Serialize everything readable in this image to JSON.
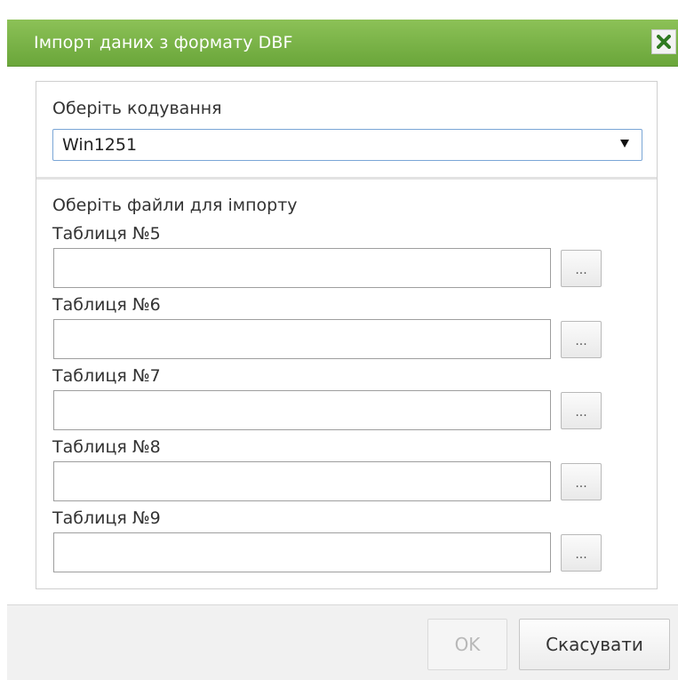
{
  "dialog": {
    "title": "Імпорт даних з формату DBF",
    "close_icon": "close-x-icon",
    "accent_color": "#7ab648"
  },
  "encoding": {
    "label": "Оберіть кодування",
    "selected": "Win1251"
  },
  "files": {
    "label": "Оберіть файли для імпорту",
    "browse_label": "...",
    "tables": [
      {
        "label": "Таблиця №5",
        "value": ""
      },
      {
        "label": "Таблиця №6",
        "value": ""
      },
      {
        "label": "Таблиця №7",
        "value": ""
      },
      {
        "label": "Таблиця №8",
        "value": ""
      },
      {
        "label": "Таблиця №9",
        "value": ""
      }
    ]
  },
  "footer": {
    "ok_label": "OK",
    "ok_enabled": false,
    "cancel_label": "Скасувати"
  }
}
